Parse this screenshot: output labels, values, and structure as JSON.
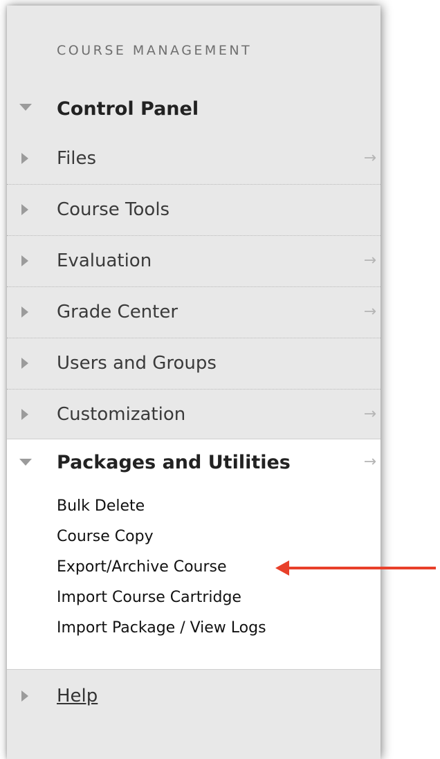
{
  "section_heading": "COURSE MANAGEMENT",
  "control_panel": {
    "label": "Control Panel"
  },
  "items": [
    {
      "label": "Files",
      "has_arrow": true
    },
    {
      "label": "Course Tools",
      "has_arrow": false
    },
    {
      "label": "Evaluation",
      "has_arrow": true
    },
    {
      "label": "Grade Center",
      "has_arrow": true
    },
    {
      "label": "Users and Groups",
      "has_arrow": false
    },
    {
      "label": "Customization",
      "has_arrow": true
    }
  ],
  "packages": {
    "label": "Packages and Utilities",
    "subitems": [
      "Bulk Delete",
      "Course Copy",
      "Export/Archive Course",
      "Import Course Cartridge",
      "Import Package / View Logs"
    ]
  },
  "help": {
    "label": "Help"
  },
  "arrow_glyph": "→",
  "colors": {
    "annotation_arrow": "#e8402a"
  }
}
